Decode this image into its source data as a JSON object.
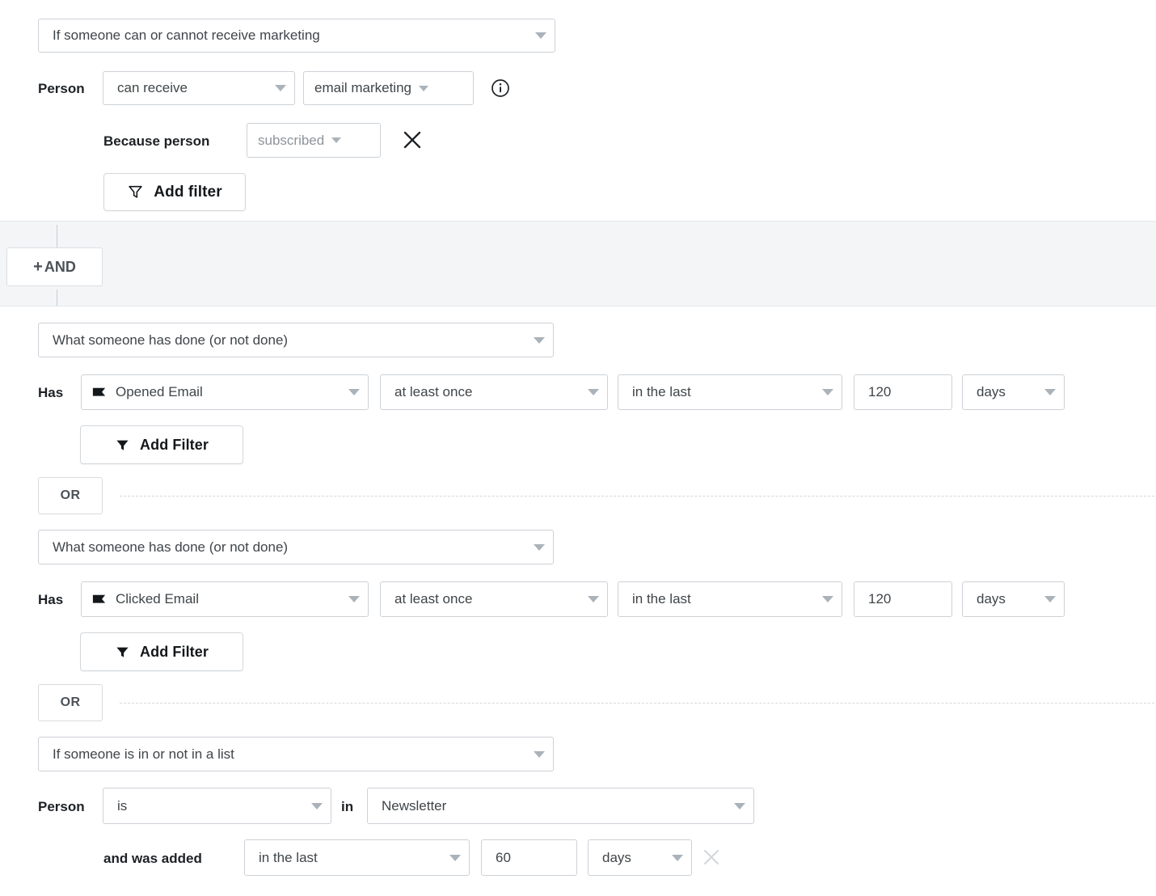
{
  "groups": [
    {
      "id": "group-1",
      "type_select": {
        "value": "If someone can or cannot receive marketing",
        "icon": "chevron-down-icon"
      },
      "rows": [
        {
          "label": "Person",
          "operator": {
            "value": "can receive"
          },
          "channel": {
            "value": "email marketing"
          },
          "info_icon": "info-circle-icon"
        },
        {
          "label": "Because person",
          "reason": {
            "value": "subscribed"
          },
          "remove_icon": "close-icon"
        }
      ],
      "add_filter": {
        "label": "Add filter",
        "icon": "filter-outline-icon"
      }
    },
    {
      "id": "group-2",
      "conditions": [
        {
          "type_select": {
            "value": "What someone has done (or not done)"
          },
          "label": "Has",
          "metric": {
            "value": "Opened Email",
            "icon": "flag-icon"
          },
          "frequency": {
            "value": "at least once"
          },
          "timeframe": {
            "value": "in the last"
          },
          "amount": {
            "value": "120"
          },
          "unit": {
            "value": "days"
          },
          "add_filter": {
            "label": "Add Filter",
            "icon": "filter-solid-icon"
          }
        },
        {
          "type_select": {
            "value": "What someone has done (or not done)"
          },
          "label": "Has",
          "metric": {
            "value": "Clicked Email",
            "icon": "flag-icon"
          },
          "frequency": {
            "value": "at least once"
          },
          "timeframe": {
            "value": "in the last"
          },
          "amount": {
            "value": "120"
          },
          "unit": {
            "value": "days"
          },
          "add_filter": {
            "label": "Add Filter",
            "icon": "filter-solid-icon"
          }
        },
        {
          "type_select": {
            "value": "If someone is in or not in a list"
          },
          "label": "Person",
          "membership": {
            "value": "is"
          },
          "in_label": "in",
          "list": {
            "value": "Newsletter"
          },
          "added_label": "and was added",
          "timeframe": {
            "value": "in the last"
          },
          "amount": {
            "value": "60"
          },
          "unit": {
            "value": "days"
          },
          "remove_icon": "close-icon"
        }
      ]
    }
  ],
  "connectors": {
    "and_button": {
      "label": "AND",
      "plus": "+"
    },
    "or_button_1": {
      "label": "OR"
    },
    "or_button_2": {
      "label": "OR"
    }
  },
  "colors": {
    "page_background": "#f4f5f6",
    "card_background": "#ffffff",
    "border": "#cdd1d6",
    "text_primary": "#3f4549",
    "text_bold": "#1d2125",
    "caret": "#aab2ba",
    "muted": "#8d949b"
  }
}
